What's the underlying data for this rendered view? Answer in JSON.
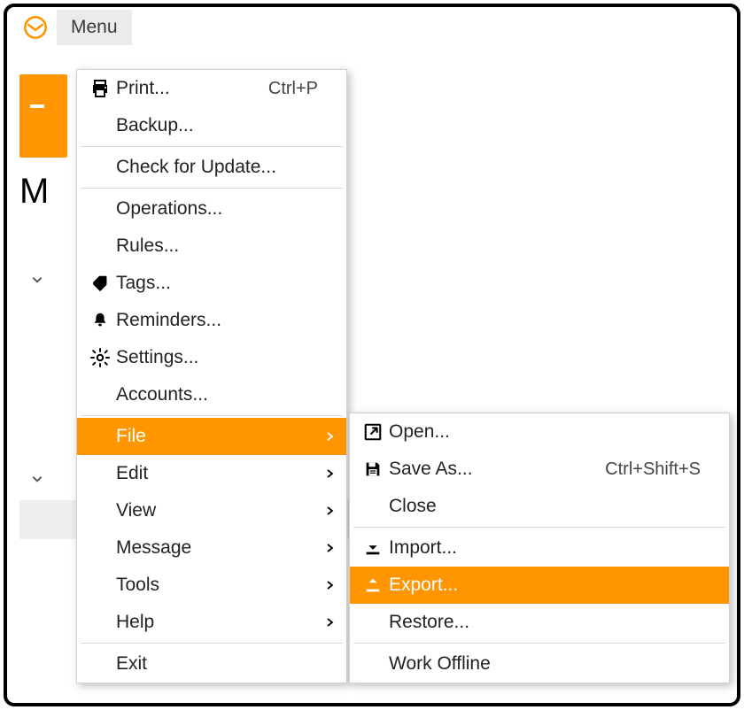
{
  "app": {
    "menu_button": "Menu",
    "page_title_fragment": "M"
  },
  "colors": {
    "accent": "#ff9500"
  },
  "menu": {
    "print": {
      "label": "Print...",
      "shortcut": "Ctrl+P"
    },
    "backup": {
      "label": "Backup..."
    },
    "check_update": {
      "label": "Check for Update..."
    },
    "operations": {
      "label": "Operations..."
    },
    "rules": {
      "label": "Rules..."
    },
    "tags": {
      "label": "Tags..."
    },
    "reminders": {
      "label": "Reminders..."
    },
    "settings": {
      "label": "Settings..."
    },
    "accounts": {
      "label": "Accounts..."
    },
    "file": {
      "label": "File"
    },
    "edit": {
      "label": "Edit"
    },
    "view": {
      "label": "View"
    },
    "message": {
      "label": "Message"
    },
    "tools": {
      "label": "Tools"
    },
    "help": {
      "label": "Help"
    },
    "exit": {
      "label": "Exit"
    }
  },
  "submenu": {
    "open": {
      "label": "Open..."
    },
    "save_as": {
      "label": "Save As...",
      "shortcut": "Ctrl+Shift+S"
    },
    "close": {
      "label": "Close"
    },
    "import": {
      "label": "Import..."
    },
    "export": {
      "label": "Export..."
    },
    "restore": {
      "label": "Restore..."
    },
    "work_offline": {
      "label": "Work Offline"
    }
  }
}
